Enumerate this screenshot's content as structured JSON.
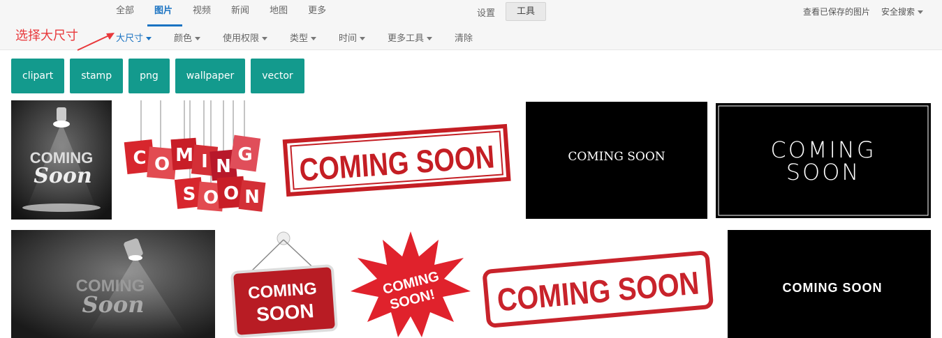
{
  "tabs": [
    {
      "label": "全部"
    },
    {
      "label": "图片"
    },
    {
      "label": "视频"
    },
    {
      "label": "新闻"
    },
    {
      "label": "地图"
    },
    {
      "label": "更多"
    }
  ],
  "settings_label": "设置",
  "tools_label": "工具",
  "saved_images_label": "查看已保存的图片",
  "safe_search_label": "安全搜索",
  "annotation": "选择大尺寸",
  "filters": [
    {
      "label": "大尺寸"
    },
    {
      "label": "颜色"
    },
    {
      "label": "使用权限"
    },
    {
      "label": "类型"
    },
    {
      "label": "时间"
    },
    {
      "label": "更多工具"
    },
    {
      "label": "清除"
    }
  ],
  "chips": [
    "clipart",
    "stamp",
    "png",
    "wallpaper",
    "vector"
  ],
  "images": {
    "img1": [
      "COMING",
      "Soon"
    ],
    "img2": [
      "C",
      "O",
      "M",
      "I",
      "N",
      "G",
      "S",
      "O",
      "O",
      "N"
    ],
    "img3": "COMING SOON",
    "img4": "COMING SOON",
    "img5": [
      "COMING",
      "SOON"
    ],
    "img6": [
      "COMING",
      "Soon"
    ],
    "img7": [
      "COMING",
      "SOON"
    ],
    "img8": [
      "COMING",
      "SOON!"
    ],
    "img9": "COMING SOON",
    "img10": "COMING SOON"
  },
  "colors": {
    "accent_blue": "#1a73c2",
    "chip_teal": "#139a8d",
    "annotation_red": "#e8383b",
    "stamp_red": "#c41e24"
  }
}
